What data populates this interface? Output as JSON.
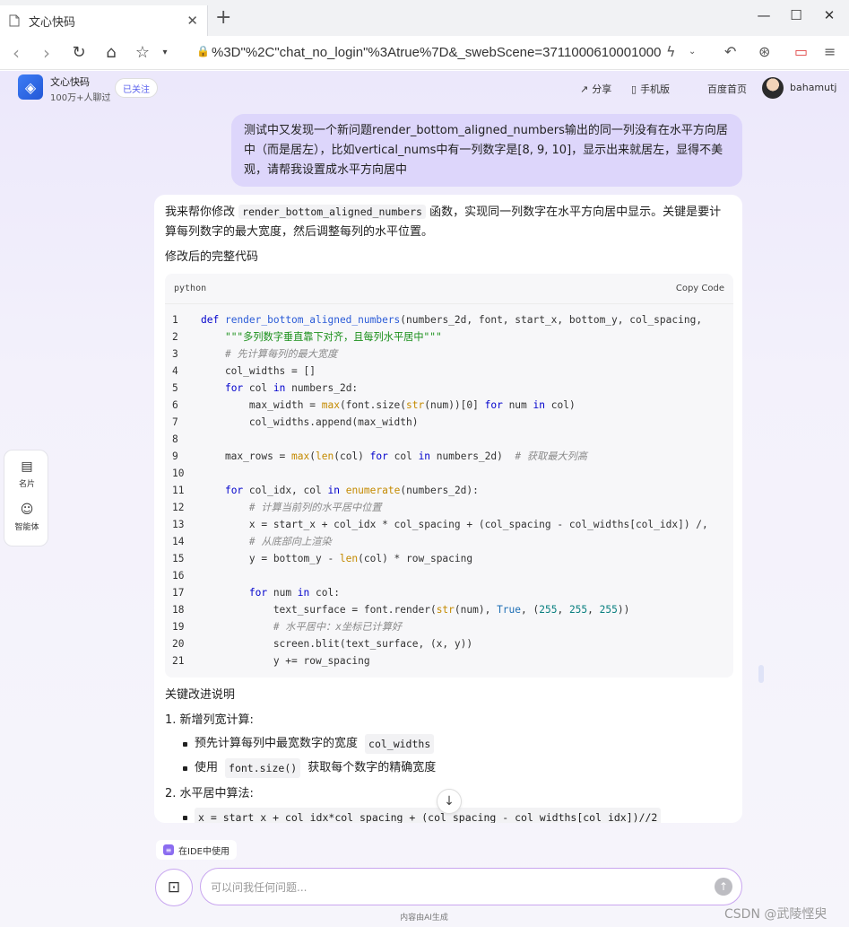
{
  "browser": {
    "tab_title": "文心快码",
    "url": "%3D\"%2C\"chat_no_login\"%3Atrue%7D&_swebScene=3711000610001000"
  },
  "header": {
    "brand": "文心快码",
    "brand_sub": "100万+人聊过",
    "follow": "已关注",
    "share": "分享",
    "mobile": "手机版",
    "baidu_home": "百度首页",
    "username": "bahamutj"
  },
  "user_message": "测试中又发现一个新问题render_bottom_aligned_numbers输出的同一列没有在水平方向居中（而是居左），比如vertical_nums中有一列数字是[8, 9, 10]，显示出来就居左，显得不美观，请帮我设置成水平方向居中",
  "answer": {
    "intro_before": "我来帮你修改",
    "intro_code": "render_bottom_aligned_numbers",
    "intro_after": "函数，实现同一列数字在水平方向居中显示。关键是要计算每列数字的最大宽度，然后调整每列的水平位置。",
    "heading": "修改后的完整代码",
    "code_lang": "python",
    "copy_label": "Copy Code",
    "code_lines": [
      "def render_bottom_aligned_numbers(numbers_2d, font, start_x, bottom_y, col_spacing,",
      "    \"\"\"多列数字垂直靠下对齐，且每列水平居中\"\"\"",
      "    # 先计算每列的最大宽度",
      "    col_widths = []",
      "    for col in numbers_2d:",
      "        max_width = max(font.size(str(num))[0] for num in col)",
      "        col_widths.append(max_width)",
      "",
      "    max_rows = max(len(col) for col in numbers_2d)  # 获取最大列高",
      "",
      "    for col_idx, col in enumerate(numbers_2d):",
      "        # 计算当前列的水平居中位置",
      "        x = start_x + col_idx * col_spacing + (col_spacing - col_widths[col_idx]) /,",
      "        # 从底部向上渲染",
      "        y = bottom_y - len(col) * row_spacing",
      "",
      "        for num in col:",
      "            text_surface = font.render(str(num), True, (255, 255, 255))",
      "            # 水平居中：x坐标已计算好",
      "            screen.blit(text_surface, (x, y))",
      "            y += row_spacing"
    ],
    "explain_heading": "关键改进说明",
    "item1": "1. 新增列宽计算:",
    "item1_sub1_text": "预先计算每列中最宽数字的宽度",
    "item1_sub1_code": "col_widths",
    "item1_sub2_before": "使用",
    "item1_sub2_code": "font.size()",
    "item1_sub2_after": "获取每个数字的精确宽度",
    "item2": "2. 水平居中算法:",
    "item2_sub1_code": "x = start_x + col_idx*col_spacing + (col_spacing - col_widths[col_idx])//2"
  },
  "side": {
    "card": "名片",
    "agent": "智能体"
  },
  "footer": {
    "ide_chip": "在IDE中使用",
    "input_placeholder": "可以问我任何问题...",
    "ai_note": "内容由AI生成",
    "watermark": "CSDN @武陵悭臾"
  }
}
